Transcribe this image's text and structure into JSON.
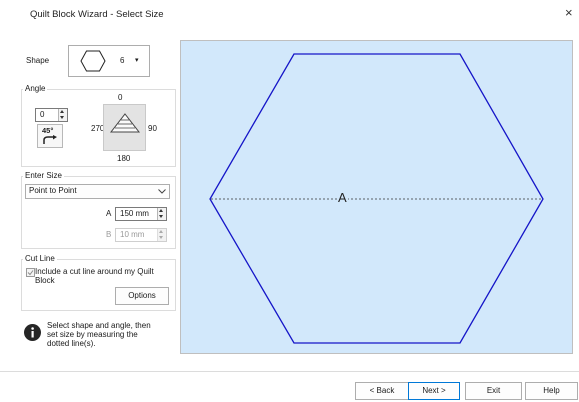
{
  "window": {
    "title": "Quilt Block Wizard - Select Size",
    "close_glyph": "×"
  },
  "shape": {
    "label": "Shape",
    "sides_value": "6",
    "dropdown_glyph": "▾",
    "icon": "hexagon-icon"
  },
  "angle": {
    "group_label": "Angle",
    "value": "0",
    "rotate_label": "45°",
    "dial": {
      "top": "0",
      "left": "270",
      "right": "90",
      "bottom": "180"
    }
  },
  "enter_size": {
    "group_label": "Enter Size",
    "mode": "Point to Point",
    "a_label": "A",
    "a_value": "150 mm",
    "b_label": "B",
    "b_value": "10 mm"
  },
  "cut_line": {
    "group_label": "Cut Line",
    "checkbox_label": "Include a cut line around my Quilt Block",
    "checked": true,
    "options_label": "Options"
  },
  "info": {
    "text": "Select shape and angle, then set size by measuring the dotted line(s).",
    "icon": "info-icon"
  },
  "preview": {
    "measure_label": "A",
    "background": "#d2e8fb",
    "outline_color": "#1515c8"
  },
  "buttons": {
    "back": "< Back",
    "next": "Next >",
    "exit": "Exit",
    "help": "Help"
  }
}
